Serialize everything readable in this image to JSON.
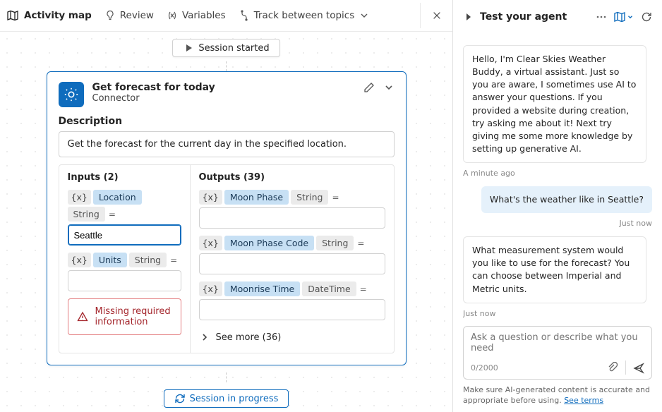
{
  "topbar": {
    "title": "Activity map",
    "review": "Review",
    "variables": "Variables",
    "track": "Track between topics"
  },
  "session": {
    "started": "Session started",
    "progress": "Session in progress"
  },
  "card": {
    "title": "Get forecast for today",
    "subtitle": "Connector",
    "descHead": "Description",
    "desc": "Get the forecast for the current day in the specified location.",
    "inputsHead": "Inputs (2)",
    "outputsHead": "Outputs (39)",
    "inputs": {
      "location": {
        "label": "Location",
        "type": "String",
        "value": "Seattle"
      },
      "units": {
        "label": "Units",
        "type": "String",
        "value": ""
      }
    },
    "outputs": {
      "moonPhase": {
        "label": "Moon Phase",
        "type": "String"
      },
      "moonPhaseCode": {
        "label": "Moon Phase Code",
        "type": "String"
      },
      "moonrise": {
        "label": "Moonrise Time",
        "type": "DateTime"
      }
    },
    "alert": "Missing required information",
    "seeMore": "See more (36)"
  },
  "test": {
    "title": "Test your agent",
    "msg1": "Hello, I'm Clear Skies Weather Buddy, a virtual assistant. Just so you are aware, I sometimes use AI to answer your questions. If you provided a website during creation, try asking me about it! Next try giving me some more knowledge by setting up generative AI.",
    "ts1": "A minute ago",
    "userMsg": "What's the weather like in Seattle?",
    "ts2": "Just now",
    "msg2": "What measurement system would you like to use for the forecast? You can choose between Imperial and Metric units.",
    "ts3": "Just now",
    "placeholder": "Ask a question or describe what you need",
    "counter": "0/2000",
    "footnote": "Make sure AI-generated content is accurate and appropriate before using. ",
    "footlink": "See terms"
  }
}
